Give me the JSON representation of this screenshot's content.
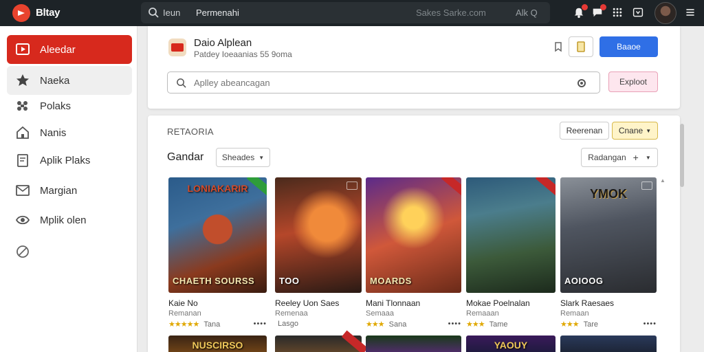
{
  "topbar": {
    "app_title": "Bltay",
    "tab_1": "Ieun",
    "tab_2": "Permenahi",
    "search_placeholder": "Sakes Sarke.com",
    "lang_label": "Alk Q"
  },
  "sidebar": {
    "items": [
      {
        "label": "Aleedar",
        "icon": "tv-play-icon",
        "active": true
      },
      {
        "label": "Naeka",
        "icon": "star-icon",
        "hover": true
      },
      {
        "label": "Polaks",
        "icon": "puzzle-icon"
      },
      {
        "label": "Nanis",
        "icon": "house-icon"
      },
      {
        "label": "Aplik Plaks",
        "icon": "document-icon"
      },
      {
        "label": "Margian",
        "icon": "mail-icon"
      },
      {
        "label": "Mplik olen",
        "icon": "eye-icon"
      }
    ],
    "extra_icon": "tag-icon"
  },
  "app_header": {
    "name": "Daio Alplean",
    "subtitle": "Patdey Ioeaanias 55 9oma",
    "primary_button": "Baaoe",
    "search_placeholder": "Aplley abeancagan",
    "explore_button": "Exploot"
  },
  "content": {
    "section_title": "RETAORIA",
    "btn_outline": "Reerenan",
    "btn_yellow": "Cnane",
    "sub_title": "Gandar",
    "filter_dropdown": "Sheades",
    "sort_dropdown": "Radangan",
    "games": [
      {
        "name": "Kaie No",
        "sub": "Remanan",
        "rating": "★★★★★",
        "count": "Tana",
        "top_title": "LONIAKARIR",
        "bottom_title": "CHAETH SOURSS"
      },
      {
        "name": "Reeley Uon Saes",
        "sub": "Remenaa",
        "rating": "",
        "count": "Lasgo",
        "top_title": "",
        "bottom_title": "TOO"
      },
      {
        "name": "Mani Tlonnaan",
        "sub": "Semaaa",
        "rating": "★★★",
        "count": "Sana",
        "top_title": "",
        "bottom_title": "MOARDS"
      },
      {
        "name": "Mokae Poelnalan",
        "sub": "Remaaan",
        "rating": "★★★",
        "count": "Tame",
        "top_title": "",
        "bottom_title": ""
      },
      {
        "name": "Slark Raesaes",
        "sub": "Remaan",
        "rating": "★★★",
        "count": "Tare",
        "top_title": "YMOK",
        "bottom_title": "AOIOOG"
      }
    ],
    "row2_titles": [
      "NUSCIRSO",
      "",
      "",
      "YAOUY",
      ""
    ]
  },
  "colors": {
    "topbar": "#1d2327",
    "accent_red": "#d7291d",
    "primary_blue": "#2f6fe6",
    "star": "#e0a800"
  }
}
